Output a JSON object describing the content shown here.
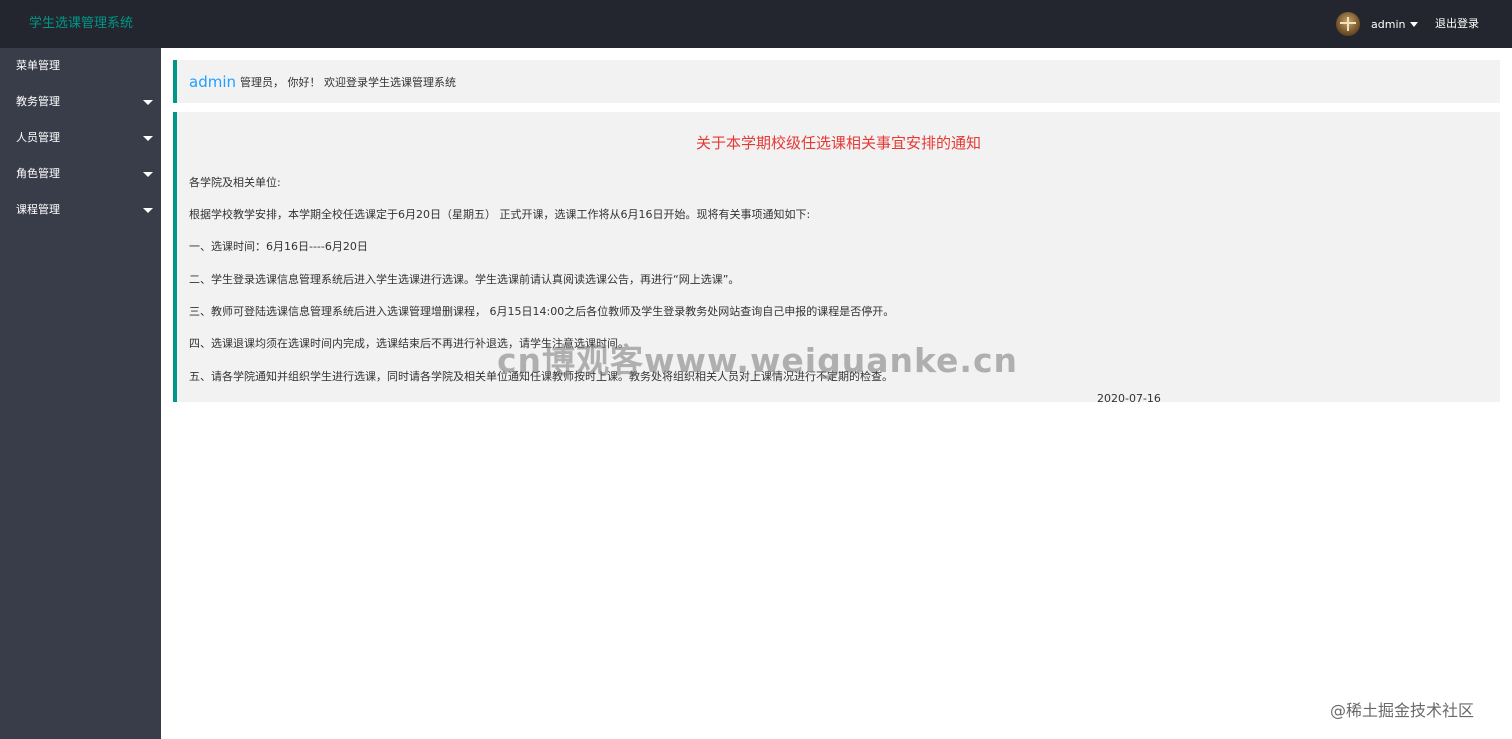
{
  "header": {
    "title": "学生选课管理系统",
    "username": "admin",
    "logout_label": "退出登录"
  },
  "sidebar": {
    "items": [
      {
        "label": "菜单管理",
        "has_arrow": false
      },
      {
        "label": "教务管理",
        "has_arrow": true
      },
      {
        "label": "人员管理",
        "has_arrow": true
      },
      {
        "label": "角色管理",
        "has_arrow": true
      },
      {
        "label": "课程管理",
        "has_arrow": true
      }
    ]
  },
  "welcome": {
    "admin_name": "admin",
    "greeting": "管理员， 你好！ 欢迎登录学生选课管理系统"
  },
  "notice": {
    "title": "关于本学期校级任选课相关事宜安排的通知",
    "paragraphs": [
      "各学院及相关单位:",
      "根据学校教学安排，本学期全校任选课定于6月20日（星期五） 正式开课，选课工作将从6月16日开始。现将有关事项通知如下:",
      "一、选课时间：6月16日----6月20日",
      "二、学生登录选课信息管理系统后进入学生选课进行选课。学生选课前请认真阅读选课公告，再进行“网上选课”。",
      "三、教师可登陆选课信息管理系统后进入选课管理增删课程， 6月15日14:00之后各位教师及学生登录教务处网站查询自己申报的课程是否停开。",
      "四、选课退课均须在选课时间内完成，选课结束后不再进行补退选，请学生注意选课时间。",
      "五、请各学院通知并组织学生进行选课，同时请各学院及相关单位通知任课教师按时上课。教务处将组织相关人员对上课情况进行不定期的检查。"
    ],
    "date": "2020-07-16"
  },
  "watermarks": {
    "center": "cn博观客www.weiguanke.cn",
    "corner": "@稀土掘金技术社区"
  },
  "colors": {
    "header_bg": "#23262e",
    "sidebar_bg": "#393d49",
    "accent": "#009688",
    "admin_name": "#1e9fff",
    "notice_title": "#e53935"
  }
}
